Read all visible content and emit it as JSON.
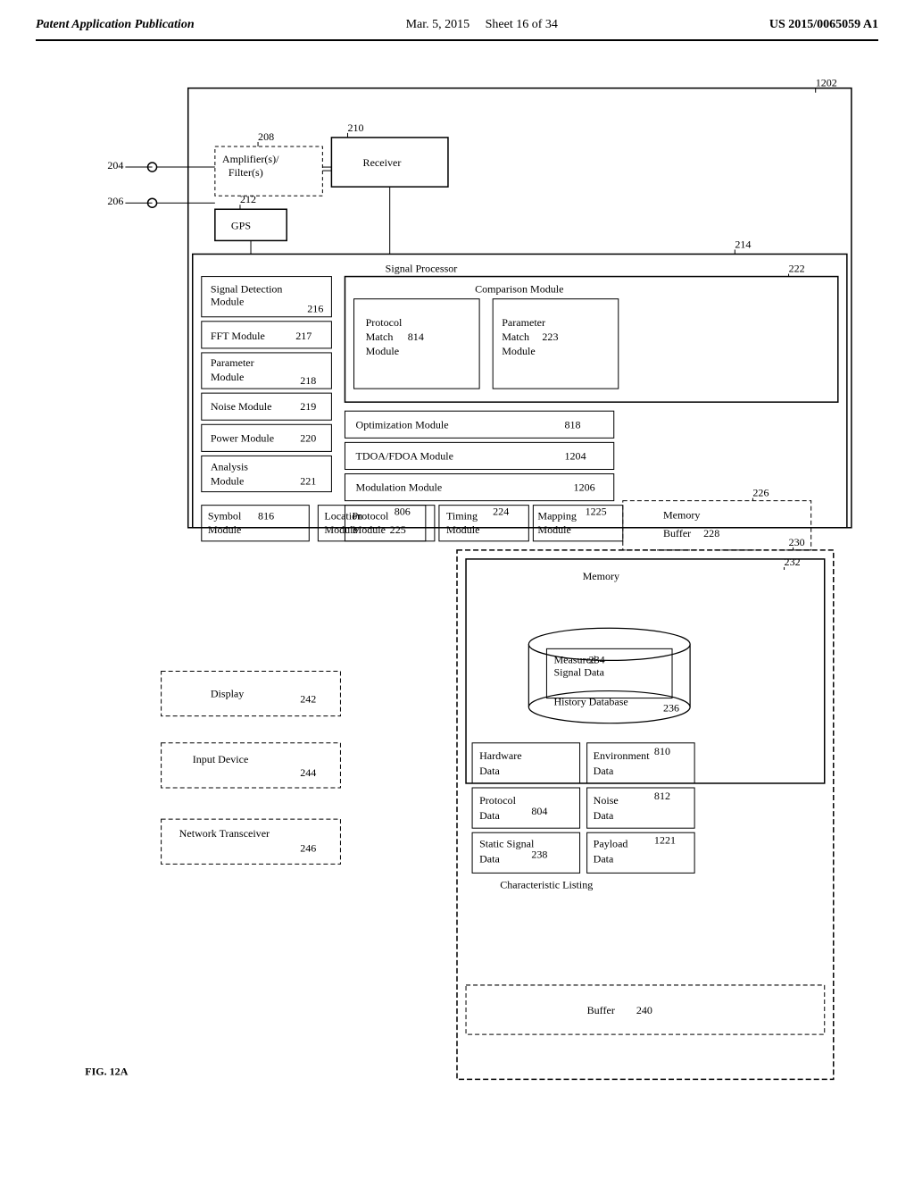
{
  "header": {
    "left": "Patent Application Publication",
    "center": "Mar. 5, 2015",
    "sheet": "Sheet 16 of 34",
    "right": "US 2015/0065059 A1"
  },
  "fig": "FIG. 12A",
  "labels": {
    "ref204": "204",
    "ref206": "206",
    "ref208": "208",
    "ref210": "210",
    "ref212": "212",
    "ref214": "214",
    "ref216": "216",
    "ref217": "217",
    "ref218": "218",
    "ref219": "219",
    "ref220": "220",
    "ref221": "221",
    "ref222": "222",
    "ref223": "223",
    "ref224": "224",
    "ref225": "225",
    "ref226": "226",
    "ref228": "228",
    "ref230": "230",
    "ref232": "232",
    "ref234": "234",
    "ref236": "236",
    "ref238": "238",
    "ref240": "240",
    "ref242": "242",
    "ref244": "244",
    "ref246": "246",
    "ref804": "804",
    "ref806": "806",
    "ref810": "810",
    "ref812": "812",
    "ref814": "814",
    "ref816": "816",
    "ref818": "818",
    "ref1202": "1202",
    "ref1204": "1204",
    "ref1206": "1206",
    "ref1221": "1221",
    "ref1225": "1225",
    "amplifiers": "Amplifier(s)/",
    "filters": "Filter(s)",
    "gps": "GPS",
    "receiver": "Receiver",
    "signalProcessor": "Signal Processor",
    "comparisonModule": "Comparison Module",
    "protocolMatch": "Protocol Match",
    "parameterMatch": "Parameter Match",
    "module814": "814",
    "module223": "223",
    "moduleLabel": "Module",
    "optimizationModule": "Optimization Module",
    "tdoaFdoa": "TDOA/FDOA Module",
    "modulationModule": "Modulation Module",
    "signalDetection": "Signal Detection",
    "moduleLabel216": "Module",
    "fftModule": "FFT Module",
    "parameterModule": "Parameter",
    "moduleParam": "Module",
    "noiseModule": "Noise Module",
    "powerModule": "Power Module",
    "analysisModule": "Analysis",
    "moduleAnalysis": "Module",
    "symbolModule": "Symbol",
    "moduleSymbol": "Module",
    "locationModule": "Location",
    "moduleLocation": "Module",
    "protocolModule": "Protocol",
    "moduleProtocol": "Module",
    "timingModule": "Timing",
    "moduleTiming": "Module",
    "mappingModule": "Mapping",
    "moduleMapping": "Module",
    "memory": "Memory",
    "buffer228": "Buffer",
    "memory232": "Memory",
    "measuredSignalData": "Measured",
    "signalData": "Signal Data",
    "historyDatabase": "History Database",
    "hardwareData": "Hardware",
    "dataLabel": "Data",
    "environmentData": "Environment",
    "data810": "Data",
    "protocolData": "Protocol",
    "data804": "Data",
    "noiseData": "Noise",
    "data812": "Data",
    "staticSignalData": "Static Signal",
    "data238": "Data",
    "payloadData": "Payload",
    "data1221": "Data",
    "characteristicListing": "Characteristic Listing",
    "bufferLabel": "Buffer",
    "display": "Display",
    "inputDevice": "Input Device",
    "networkTransceiver": "Network Transceiver"
  }
}
